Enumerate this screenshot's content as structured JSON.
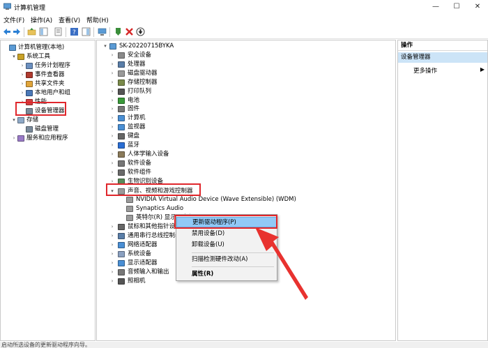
{
  "window": {
    "title": "计算机管理",
    "controls": [
      "—",
      "☐",
      "✕"
    ]
  },
  "menus": [
    "文件(F)",
    "操作(A)",
    "查看(V)",
    "帮助(H)"
  ],
  "left_tree": [
    {
      "label": "计算机管理(本地)",
      "indent": 0,
      "arrow": ""
    },
    {
      "label": "系统工具",
      "indent": 1,
      "arrow": "▾"
    },
    {
      "label": "任务计划程序",
      "indent": 2,
      "arrow": "›"
    },
    {
      "label": "事件查看器",
      "indent": 2,
      "arrow": "›"
    },
    {
      "label": "共享文件夹",
      "indent": 2,
      "arrow": "›"
    },
    {
      "label": "本地用户和组",
      "indent": 2,
      "arrow": "›"
    },
    {
      "label": "性能",
      "indent": 2,
      "arrow": "›"
    },
    {
      "label": "设备管理器",
      "indent": 2,
      "arrow": ""
    },
    {
      "label": "存储",
      "indent": 1,
      "arrow": "▾"
    },
    {
      "label": "磁盘管理",
      "indent": 2,
      "arrow": ""
    },
    {
      "label": "服务和应用程序",
      "indent": 1,
      "arrow": "›"
    }
  ],
  "device_tree": {
    "root": "SK-20220715BYKA",
    "categories_top": [
      "安全设备",
      "处理器",
      "磁盘驱动器",
      "存储控制器",
      "打印队列",
      "电池",
      "固件",
      "计算机",
      "监视器",
      "键盘",
      "蓝牙",
      "人体学输入设备",
      "软件设备",
      "软件组件",
      "生物识别设备"
    ],
    "expanded": "声音、视频和游戏控制器",
    "children": [
      "NVIDIA Virtual Audio Device (Wave Extensible) (WDM)",
      "Synaptics Audio",
      "英特尔(R) 显示器音频"
    ],
    "categories_bottom": [
      "鼠标和其他指针设备",
      "通用串行总线控制器",
      "网络适配器",
      "系统设备",
      "显示适配器",
      "音频输入和输出",
      "照相机"
    ]
  },
  "context_menu": {
    "items": [
      "更新驱动程序(P)",
      "禁用设备(D)",
      "卸载设备(U)",
      "扫描检测硬件改动(A)",
      "属性(R)"
    ]
  },
  "actions": {
    "header": "操作",
    "selected": "设备管理器",
    "more": "更多操作"
  },
  "status": {
    "text": "启动所选设备的更新驱动程序向导。"
  }
}
